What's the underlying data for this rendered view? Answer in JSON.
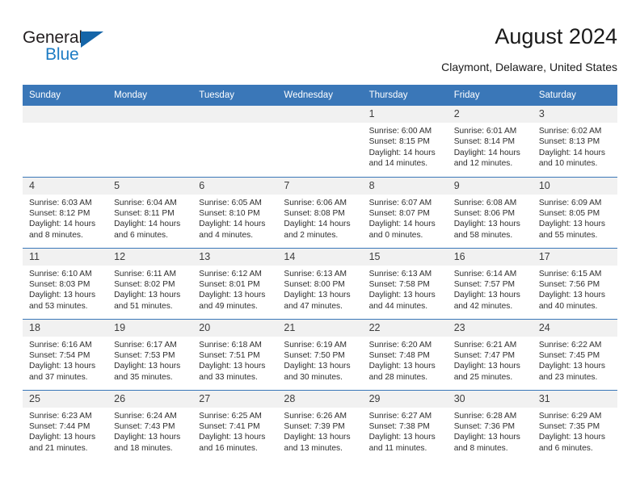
{
  "brand": {
    "name_top": "General",
    "name_bottom": "Blue",
    "triangle_color": "#1565a8",
    "blue_text_color": "#1d7cc4"
  },
  "header": {
    "title": "August 2024",
    "subtitle": "Claymont, Delaware, United States"
  },
  "calendar": {
    "header_color": "#3a77b8",
    "daynum_bg": "#f1f1f1",
    "weekday_headers": [
      "Sunday",
      "Monday",
      "Tuesday",
      "Wednesday",
      "Thursday",
      "Friday",
      "Saturday"
    ],
    "weeks": [
      [
        {
          "day": "",
          "empty": true,
          "sunrise": "",
          "sunset": "",
          "daylight1": "",
          "daylight2": ""
        },
        {
          "day": "",
          "empty": true,
          "sunrise": "",
          "sunset": "",
          "daylight1": "",
          "daylight2": ""
        },
        {
          "day": "",
          "empty": true,
          "sunrise": "",
          "sunset": "",
          "daylight1": "",
          "daylight2": ""
        },
        {
          "day": "",
          "empty": true,
          "sunrise": "",
          "sunset": "",
          "daylight1": "",
          "daylight2": ""
        },
        {
          "day": "1",
          "empty": false,
          "sunrise": "Sunrise: 6:00 AM",
          "sunset": "Sunset: 8:15 PM",
          "daylight1": "Daylight: 14 hours",
          "daylight2": "and 14 minutes."
        },
        {
          "day": "2",
          "empty": false,
          "sunrise": "Sunrise: 6:01 AM",
          "sunset": "Sunset: 8:14 PM",
          "daylight1": "Daylight: 14 hours",
          "daylight2": "and 12 minutes."
        },
        {
          "day": "3",
          "empty": false,
          "sunrise": "Sunrise: 6:02 AM",
          "sunset": "Sunset: 8:13 PM",
          "daylight1": "Daylight: 14 hours",
          "daylight2": "and 10 minutes."
        }
      ],
      [
        {
          "day": "4",
          "empty": false,
          "sunrise": "Sunrise: 6:03 AM",
          "sunset": "Sunset: 8:12 PM",
          "daylight1": "Daylight: 14 hours",
          "daylight2": "and 8 minutes."
        },
        {
          "day": "5",
          "empty": false,
          "sunrise": "Sunrise: 6:04 AM",
          "sunset": "Sunset: 8:11 PM",
          "daylight1": "Daylight: 14 hours",
          "daylight2": "and 6 minutes."
        },
        {
          "day": "6",
          "empty": false,
          "sunrise": "Sunrise: 6:05 AM",
          "sunset": "Sunset: 8:10 PM",
          "daylight1": "Daylight: 14 hours",
          "daylight2": "and 4 minutes."
        },
        {
          "day": "7",
          "empty": false,
          "sunrise": "Sunrise: 6:06 AM",
          "sunset": "Sunset: 8:08 PM",
          "daylight1": "Daylight: 14 hours",
          "daylight2": "and 2 minutes."
        },
        {
          "day": "8",
          "empty": false,
          "sunrise": "Sunrise: 6:07 AM",
          "sunset": "Sunset: 8:07 PM",
          "daylight1": "Daylight: 14 hours",
          "daylight2": "and 0 minutes."
        },
        {
          "day": "9",
          "empty": false,
          "sunrise": "Sunrise: 6:08 AM",
          "sunset": "Sunset: 8:06 PM",
          "daylight1": "Daylight: 13 hours",
          "daylight2": "and 58 minutes."
        },
        {
          "day": "10",
          "empty": false,
          "sunrise": "Sunrise: 6:09 AM",
          "sunset": "Sunset: 8:05 PM",
          "daylight1": "Daylight: 13 hours",
          "daylight2": "and 55 minutes."
        }
      ],
      [
        {
          "day": "11",
          "empty": false,
          "sunrise": "Sunrise: 6:10 AM",
          "sunset": "Sunset: 8:03 PM",
          "daylight1": "Daylight: 13 hours",
          "daylight2": "and 53 minutes."
        },
        {
          "day": "12",
          "empty": false,
          "sunrise": "Sunrise: 6:11 AM",
          "sunset": "Sunset: 8:02 PM",
          "daylight1": "Daylight: 13 hours",
          "daylight2": "and 51 minutes."
        },
        {
          "day": "13",
          "empty": false,
          "sunrise": "Sunrise: 6:12 AM",
          "sunset": "Sunset: 8:01 PM",
          "daylight1": "Daylight: 13 hours",
          "daylight2": "and 49 minutes."
        },
        {
          "day": "14",
          "empty": false,
          "sunrise": "Sunrise: 6:13 AM",
          "sunset": "Sunset: 8:00 PM",
          "daylight1": "Daylight: 13 hours",
          "daylight2": "and 47 minutes."
        },
        {
          "day": "15",
          "empty": false,
          "sunrise": "Sunrise: 6:13 AM",
          "sunset": "Sunset: 7:58 PM",
          "daylight1": "Daylight: 13 hours",
          "daylight2": "and 44 minutes."
        },
        {
          "day": "16",
          "empty": false,
          "sunrise": "Sunrise: 6:14 AM",
          "sunset": "Sunset: 7:57 PM",
          "daylight1": "Daylight: 13 hours",
          "daylight2": "and 42 minutes."
        },
        {
          "day": "17",
          "empty": false,
          "sunrise": "Sunrise: 6:15 AM",
          "sunset": "Sunset: 7:56 PM",
          "daylight1": "Daylight: 13 hours",
          "daylight2": "and 40 minutes."
        }
      ],
      [
        {
          "day": "18",
          "empty": false,
          "sunrise": "Sunrise: 6:16 AM",
          "sunset": "Sunset: 7:54 PM",
          "daylight1": "Daylight: 13 hours",
          "daylight2": "and 37 minutes."
        },
        {
          "day": "19",
          "empty": false,
          "sunrise": "Sunrise: 6:17 AM",
          "sunset": "Sunset: 7:53 PM",
          "daylight1": "Daylight: 13 hours",
          "daylight2": "and 35 minutes."
        },
        {
          "day": "20",
          "empty": false,
          "sunrise": "Sunrise: 6:18 AM",
          "sunset": "Sunset: 7:51 PM",
          "daylight1": "Daylight: 13 hours",
          "daylight2": "and 33 minutes."
        },
        {
          "day": "21",
          "empty": false,
          "sunrise": "Sunrise: 6:19 AM",
          "sunset": "Sunset: 7:50 PM",
          "daylight1": "Daylight: 13 hours",
          "daylight2": "and 30 minutes."
        },
        {
          "day": "22",
          "empty": false,
          "sunrise": "Sunrise: 6:20 AM",
          "sunset": "Sunset: 7:48 PM",
          "daylight1": "Daylight: 13 hours",
          "daylight2": "and 28 minutes."
        },
        {
          "day": "23",
          "empty": false,
          "sunrise": "Sunrise: 6:21 AM",
          "sunset": "Sunset: 7:47 PM",
          "daylight1": "Daylight: 13 hours",
          "daylight2": "and 25 minutes."
        },
        {
          "day": "24",
          "empty": false,
          "sunrise": "Sunrise: 6:22 AM",
          "sunset": "Sunset: 7:45 PM",
          "daylight1": "Daylight: 13 hours",
          "daylight2": "and 23 minutes."
        }
      ],
      [
        {
          "day": "25",
          "empty": false,
          "sunrise": "Sunrise: 6:23 AM",
          "sunset": "Sunset: 7:44 PM",
          "daylight1": "Daylight: 13 hours",
          "daylight2": "and 21 minutes."
        },
        {
          "day": "26",
          "empty": false,
          "sunrise": "Sunrise: 6:24 AM",
          "sunset": "Sunset: 7:43 PM",
          "daylight1": "Daylight: 13 hours",
          "daylight2": "and 18 minutes."
        },
        {
          "day": "27",
          "empty": false,
          "sunrise": "Sunrise: 6:25 AM",
          "sunset": "Sunset: 7:41 PM",
          "daylight1": "Daylight: 13 hours",
          "daylight2": "and 16 minutes."
        },
        {
          "day": "28",
          "empty": false,
          "sunrise": "Sunrise: 6:26 AM",
          "sunset": "Sunset: 7:39 PM",
          "daylight1": "Daylight: 13 hours",
          "daylight2": "and 13 minutes."
        },
        {
          "day": "29",
          "empty": false,
          "sunrise": "Sunrise: 6:27 AM",
          "sunset": "Sunset: 7:38 PM",
          "daylight1": "Daylight: 13 hours",
          "daylight2": "and 11 minutes."
        },
        {
          "day": "30",
          "empty": false,
          "sunrise": "Sunrise: 6:28 AM",
          "sunset": "Sunset: 7:36 PM",
          "daylight1": "Daylight: 13 hours",
          "daylight2": "and 8 minutes."
        },
        {
          "day": "31",
          "empty": false,
          "sunrise": "Sunrise: 6:29 AM",
          "sunset": "Sunset: 7:35 PM",
          "daylight1": "Daylight: 13 hours",
          "daylight2": "and 6 minutes."
        }
      ]
    ]
  }
}
